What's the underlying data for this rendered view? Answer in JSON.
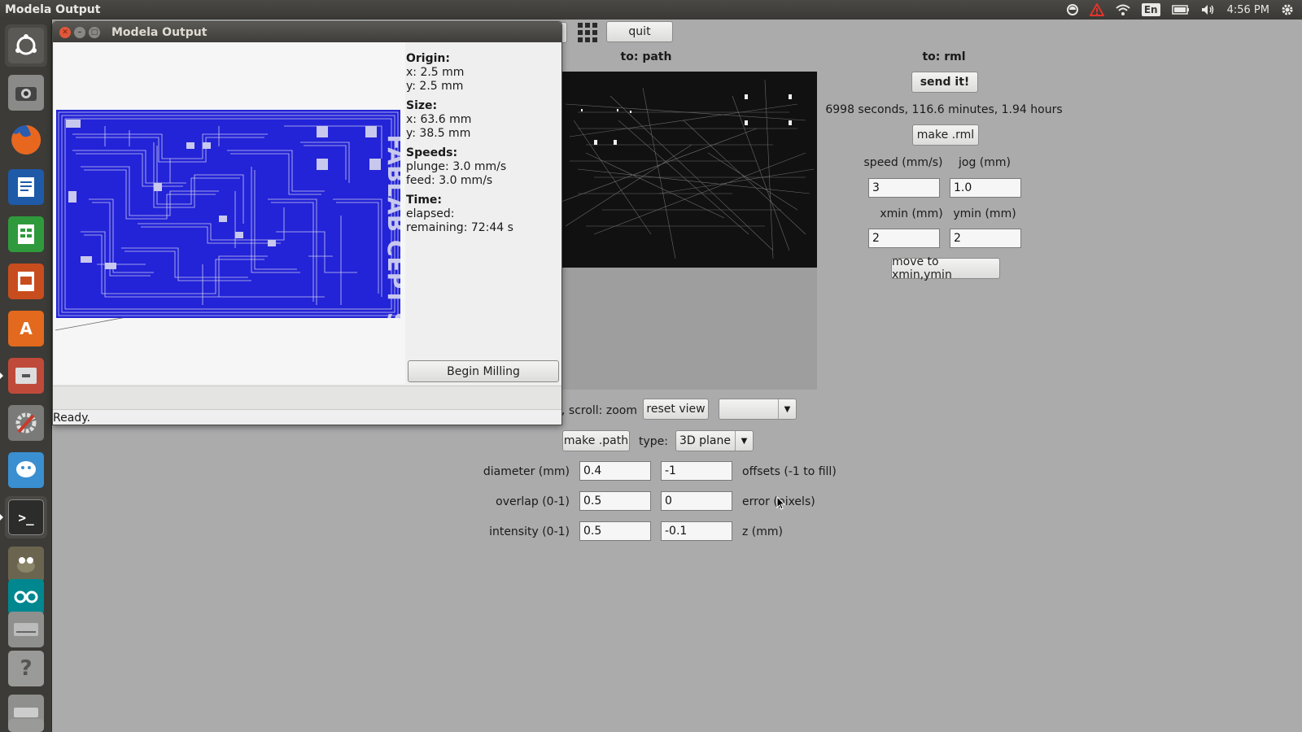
{
  "topbar": {
    "title": "Modela Output",
    "keyboard": "En",
    "time": "4:56 PM",
    "icons": [
      "network-icon",
      "warning-icon",
      "wifi-icon",
      "keyboard-icon",
      "battery-icon",
      "volume-icon",
      "gear-icon"
    ]
  },
  "launcher": {
    "items": [
      "ubuntu-dash-icon",
      "camera-icon",
      "firefox-icon",
      "writer-icon",
      "calc-icon",
      "impress-icon",
      "software-center-icon",
      "files-icon",
      "system-settings-icon",
      "empathy-icon",
      "terminal-icon",
      "gimp-icon",
      "arduino-icon",
      "drive-icon",
      "help-icon",
      "usb-icon",
      "trash-icon"
    ]
  },
  "toolbar": {
    "quit_label": "quit"
  },
  "path_panel": {
    "title": "to: path"
  },
  "rml_panel": {
    "title": "to: rml",
    "send_label": "send it!",
    "time_estimate": "6998 seconds, 116.6 minutes, 1.94 hours",
    "make_rml_label": "make .rml",
    "speed_label": "speed (mm/s)",
    "jog_label": "jog (mm)",
    "speed_value": "3",
    "jog_value": "1.0",
    "xmin_label": "xmin (mm)",
    "ymin_label": "ymin (mm)",
    "xmin_value": "2",
    "ymin_value": "2",
    "move_label": "move to xmin,ymin"
  },
  "view_controls": {
    "scroll_text": ", scroll: zoom",
    "reset_label": "reset view",
    "view_select": ""
  },
  "path_controls": {
    "make_path_label": "make .path",
    "type_label": "type:",
    "type_value": "3D plane",
    "diameter_label": "diameter (mm)",
    "diameter_value": "0.4",
    "offsets_value": "-1",
    "offsets_label": "offsets (-1 to fill)",
    "overlap_label": "overlap (0-1)",
    "overlap_value": "0.5",
    "error_value": "0",
    "error_label": "error (pixels)",
    "intensity_label": "intensity (0-1)",
    "intensity_value": "0.5",
    "z_value": "-0.1",
    "z_label": "z (mm)"
  },
  "dialog": {
    "title": "Modela Output",
    "origin_heading": "Origin:",
    "origin_x": "x: 2.5 mm",
    "origin_y": "y: 2.5 mm",
    "size_heading": "Size:",
    "size_x": "x: 63.6 mm",
    "size_y": "y: 38.5 mm",
    "speeds_heading": "Speeds:",
    "plunge": "plunge: 3.0 mm/s",
    "feed": "feed: 3.0 mm/s",
    "time_heading": "Time:",
    "elapsed": "elapsed:",
    "remaining": "remaining: 72:44 s",
    "begin_label": "Begin Milling",
    "status": "Ready.",
    "board_text": "FABLAB CEPT SP"
  },
  "colors": {
    "toolpath": "#1f1fe0",
    "topbar": "#3c3b37",
    "background": "#ababab"
  }
}
